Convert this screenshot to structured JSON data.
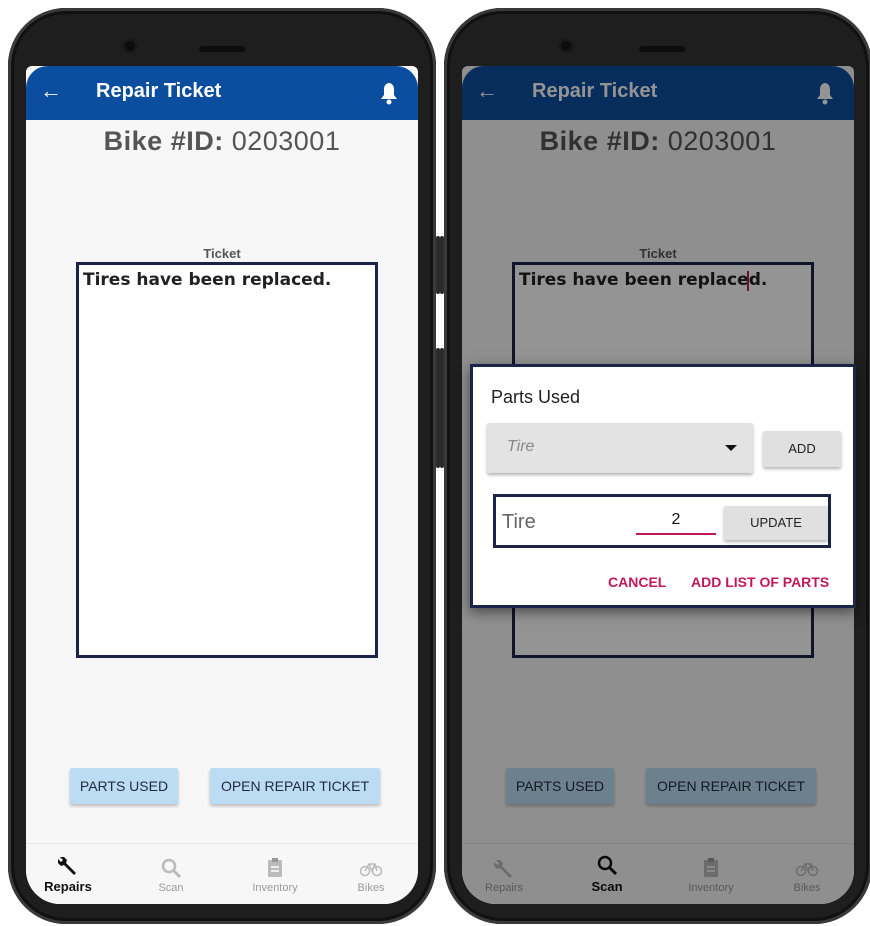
{
  "screens": [
    {
      "appbar": {
        "back": "←",
        "title": "Repair Ticket"
      },
      "bike_id": {
        "label": "Bike #ID:",
        "value": "0203001"
      },
      "ticket": {
        "label": "Ticket",
        "text": "Tires have been replaced."
      },
      "buttons": {
        "parts_used": "PARTS USED",
        "open_ticket": "OPEN REPAIR TICKET"
      },
      "nav": [
        {
          "label": "Repairs",
          "icon": "wrench-icon",
          "active": true
        },
        {
          "label": "Scan",
          "icon": "search-icon",
          "active": false
        },
        {
          "label": "Inventory",
          "icon": "clipboard-icon",
          "active": false
        },
        {
          "label": "Bikes",
          "icon": "bike-icon",
          "active": false
        }
      ]
    },
    {
      "appbar": {
        "back": "←",
        "title": "Repair Ticket"
      },
      "bike_id": {
        "label": "Bike #ID:",
        "value": "0203001"
      },
      "ticket": {
        "label": "Ticket",
        "text": "Tires have been replaced."
      },
      "buttons": {
        "parts_used": "PARTS USED",
        "open_ticket": "OPEN REPAIR TICKET"
      },
      "nav": [
        {
          "label": "Repairs",
          "icon": "wrench-icon",
          "active": false
        },
        {
          "label": "Scan",
          "icon": "search-icon",
          "active": true
        },
        {
          "label": "Inventory",
          "icon": "clipboard-icon",
          "active": false
        },
        {
          "label": "Bikes",
          "icon": "bike-icon",
          "active": false
        }
      ],
      "dialog": {
        "title": "Parts Used",
        "dropdown_value": "Tire",
        "add_label": "ADD",
        "part": {
          "name": "Tire",
          "quantity": "2",
          "update_label": "UPDATE"
        },
        "cancel_label": "CANCEL",
        "add_list_label": "ADD LIST OF PARTS"
      }
    }
  ],
  "colors": {
    "appbar": "#0b4e9f",
    "button": "#bcdcf4",
    "accent": "#c2185b",
    "border": "#1b2446"
  }
}
